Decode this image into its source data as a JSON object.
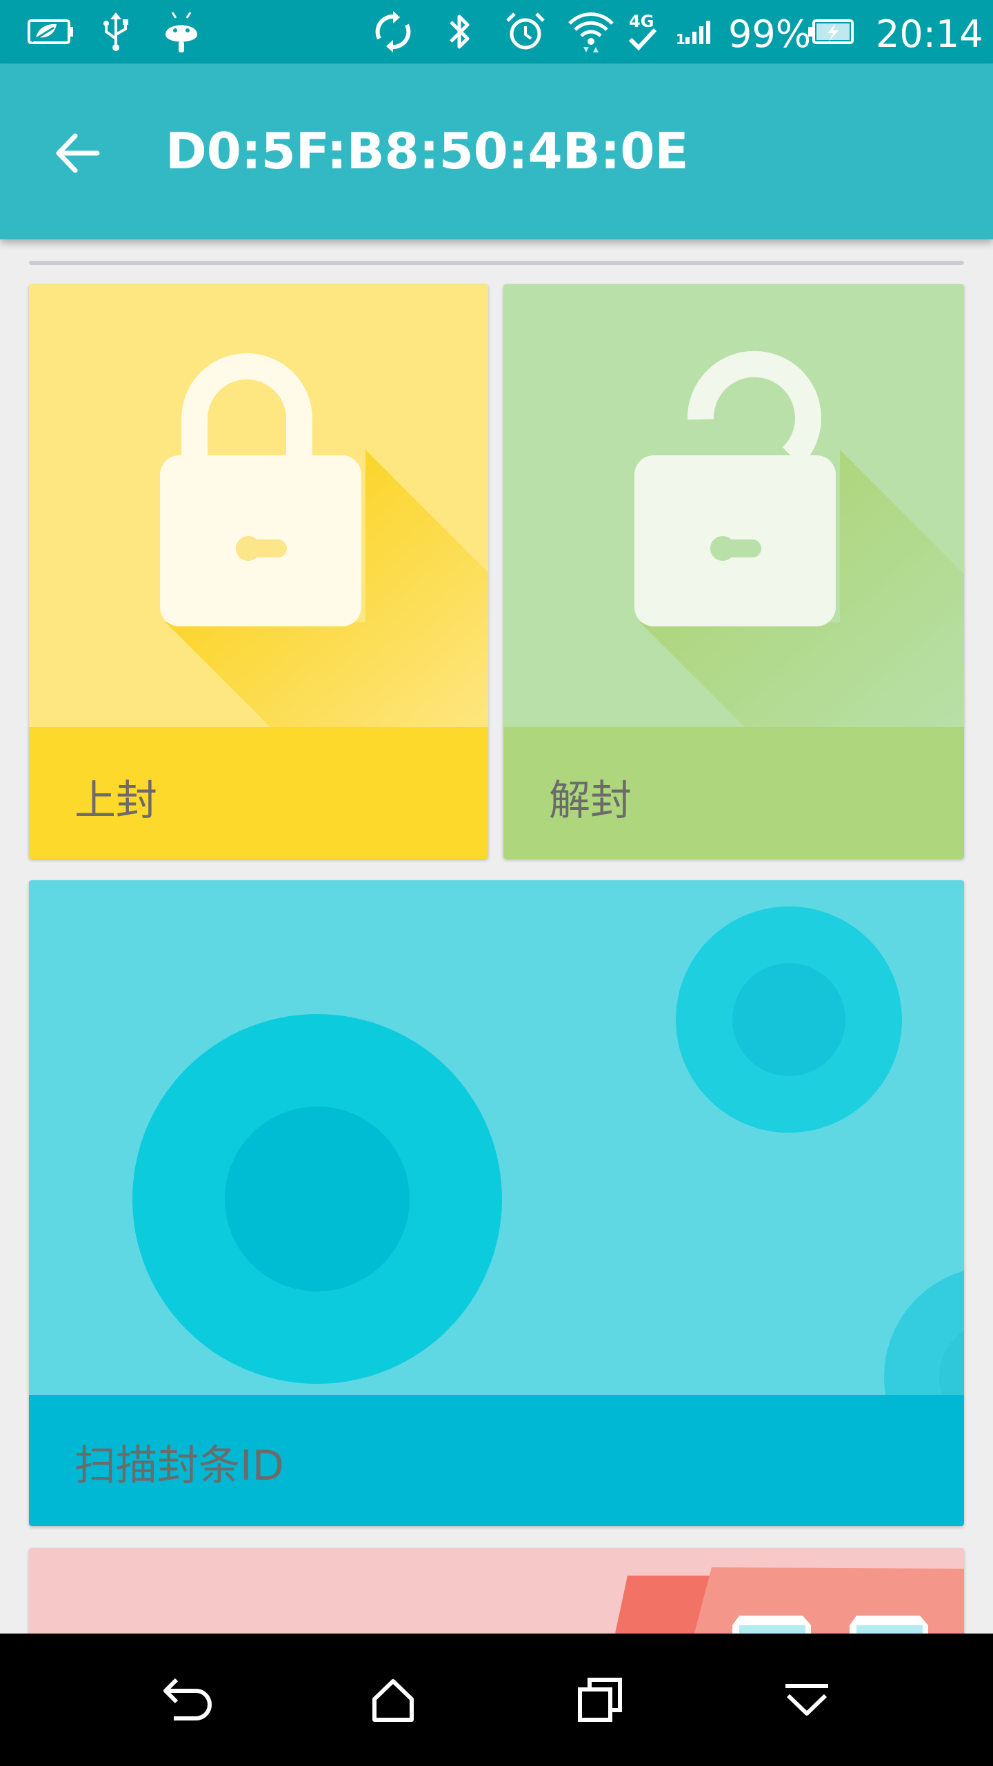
{
  "status_bar": {
    "battery_percent": "99%",
    "time": "20:14",
    "network_type": "4G",
    "icons": [
      "eco-battery-icon",
      "usb-icon",
      "android-icon",
      "sync-icon",
      "bluetooth-icon",
      "alarm-icon",
      "wifi-icon",
      "network-4g-icon",
      "signal-icon",
      "battery-charging-icon"
    ]
  },
  "app_bar": {
    "title": "D0:5F:B8:50:4B:0E",
    "back_icon": "arrow-back-icon"
  },
  "cards": [
    {
      "label": "上封",
      "icon": "lock-closed-icon",
      "art_color": "#fee680",
      "label_color": "#fdd92b"
    },
    {
      "label": "解封",
      "icon": "lock-open-icon",
      "art_color": "#b8e0a8",
      "label_color": "#aed67c"
    },
    {
      "label": "扫描封条ID",
      "icon": "scan-circles-art",
      "art_color": "#5fd8e4",
      "label_color": "#00b8d4"
    },
    {
      "label": "",
      "icon": "houses-art",
      "art_color": "#f7c8c8"
    }
  ],
  "nav_bar": {
    "icons": [
      "back-nav-icon",
      "home-nav-icon",
      "recents-nav-icon",
      "hide-nav-icon"
    ]
  }
}
